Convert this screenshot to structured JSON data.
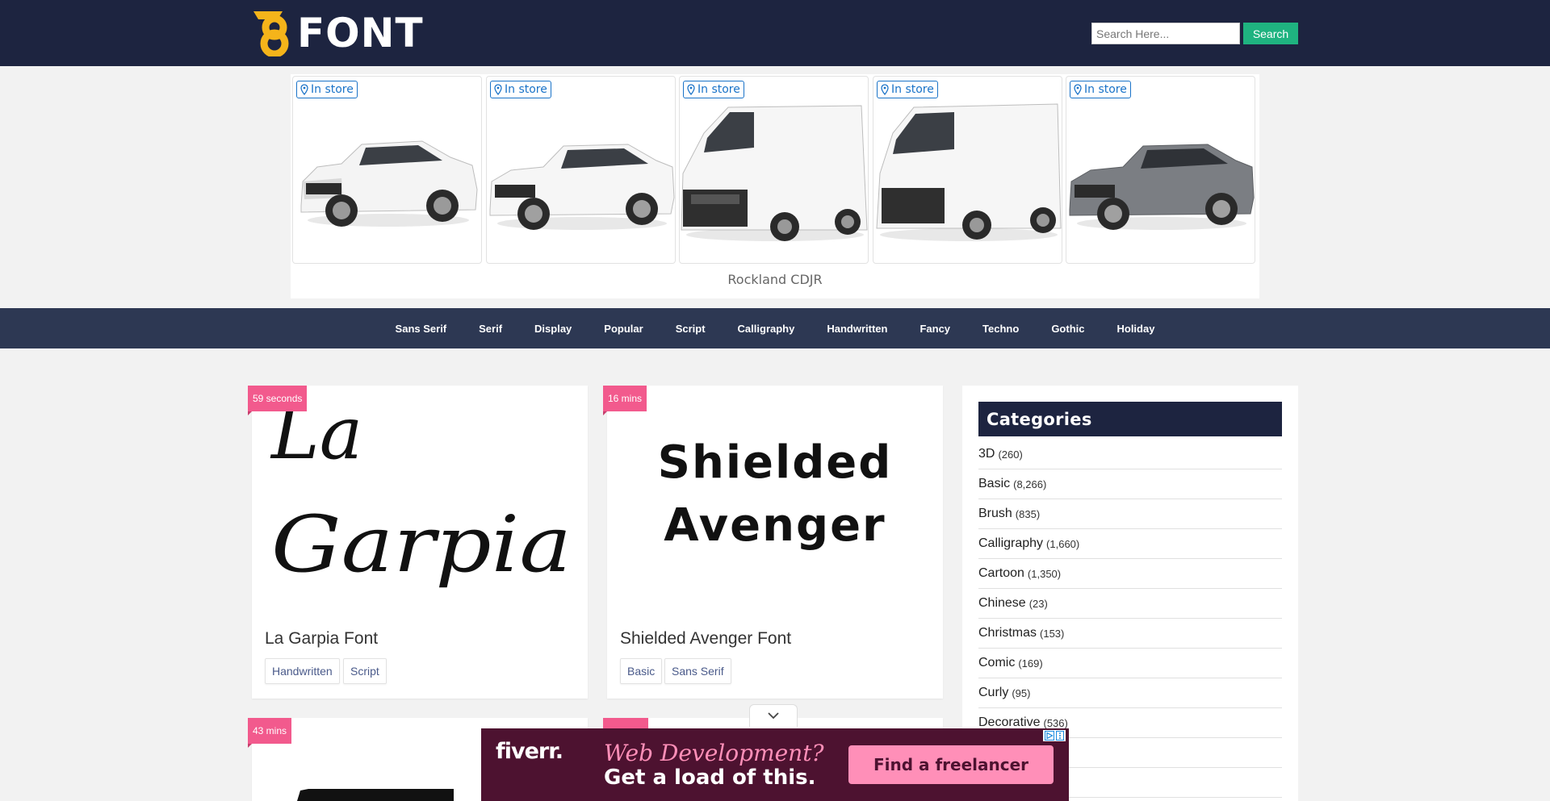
{
  "header": {
    "logo_text": "FONT",
    "search_placeholder": "Search Here...",
    "search_button": "Search"
  },
  "top_ad": {
    "tiles": [
      {
        "badge": "In store",
        "vehicle": "white compact SUV"
      },
      {
        "badge": "In store",
        "vehicle": "white large SUV"
      },
      {
        "badge": "In store",
        "vehicle": "white cargo van"
      },
      {
        "badge": "In store",
        "vehicle": "white high-roof cargo van"
      },
      {
        "badge": "In store",
        "vehicle": "gray large SUV"
      }
    ],
    "caption": "Rockland CDJR"
  },
  "nav": {
    "items": [
      "Sans Serif",
      "Serif",
      "Display",
      "Popular",
      "Script",
      "Calligraphy",
      "Handwritten",
      "Fancy",
      "Techno",
      "Gothic",
      "Holiday"
    ]
  },
  "cards": [
    {
      "time": "59 seconds",
      "preview_lines": [
        "La",
        "Garpia"
      ],
      "title": "La Garpia Font",
      "tags": [
        "Handwritten",
        "Script"
      ]
    },
    {
      "time": "16 mins",
      "preview_lines": [
        "Shielded",
        "Avenger"
      ],
      "title": "Shielded Avenger Font",
      "tags": [
        "Basic",
        "Sans Serif"
      ]
    },
    {
      "time": "43 mins"
    }
  ],
  "sidebar": {
    "heading": "Categories",
    "items": [
      {
        "name": "3D",
        "count": "(260)"
      },
      {
        "name": "Basic",
        "count": "(8,266)"
      },
      {
        "name": "Brush",
        "count": "(835)"
      },
      {
        "name": "Calligraphy",
        "count": "(1,660)"
      },
      {
        "name": "Cartoon",
        "count": "(1,350)"
      },
      {
        "name": "Chinese",
        "count": "(23)"
      },
      {
        "name": "Christmas",
        "count": "(153)"
      },
      {
        "name": "Comic",
        "count": "(169)"
      },
      {
        "name": "Curly",
        "count": "(95)"
      },
      {
        "name": "Decorative",
        "count": "(536)"
      }
    ]
  },
  "bottom_ad": {
    "brand": "fiverr.",
    "headline": "Web Development?",
    "subline": "Get a load of this.",
    "cta": "Find a freelancer"
  },
  "colors": {
    "header_bg": "#1d2440",
    "nav_bg": "#2d3853",
    "search_btn": "#1fb380",
    "time_badge": "#f25a8d",
    "logo_accent": "#f5b41a"
  }
}
